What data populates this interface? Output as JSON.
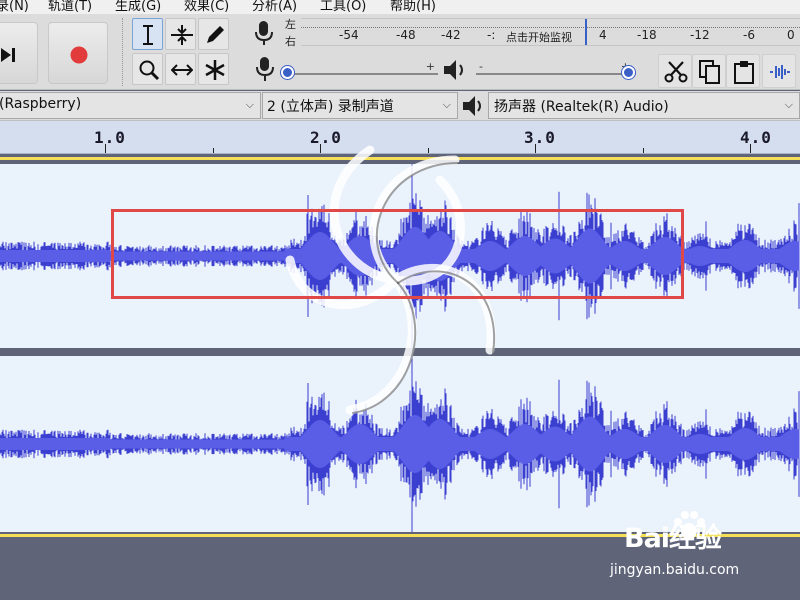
{
  "menu": {
    "items": [
      "录(N)",
      "轨道(T)",
      "生成(G)",
      "效果(C)",
      "分析(A)",
      "工具(O)",
      "帮助(H)"
    ]
  },
  "toolbar": {
    "tools": [
      "selection-tool",
      "envelope-tool",
      "draw-tool",
      "zoom-tool",
      "timeshift-tool",
      "multi-tool"
    ],
    "meter": {
      "left_label": "左",
      "right_label": "右",
      "ticks": [
        "-54",
        "-48",
        "-42",
        "-:",
        "点击开始监视",
        "4",
        "-18",
        "-12",
        "-6",
        "0"
      ]
    },
    "sliders": {
      "minus": "-",
      "plus": "+"
    }
  },
  "devices": {
    "input_device": "(Raspberry)",
    "channels": "2 (立体声) 录制声道",
    "output_device": "扬声器 (Realtek(R) Audio)"
  },
  "ruler": {
    "labels": [
      "1.0",
      "2.0",
      "3.0",
      "4.0"
    ]
  },
  "watermark": {
    "logo": "Bai经验",
    "url": "jingyan.baidu.com"
  },
  "colors": {
    "waveform": "#3b3fd0",
    "track_bg": "#eaf2fc",
    "selection_box": "#e04848",
    "clip_divider": "#f4df56"
  }
}
